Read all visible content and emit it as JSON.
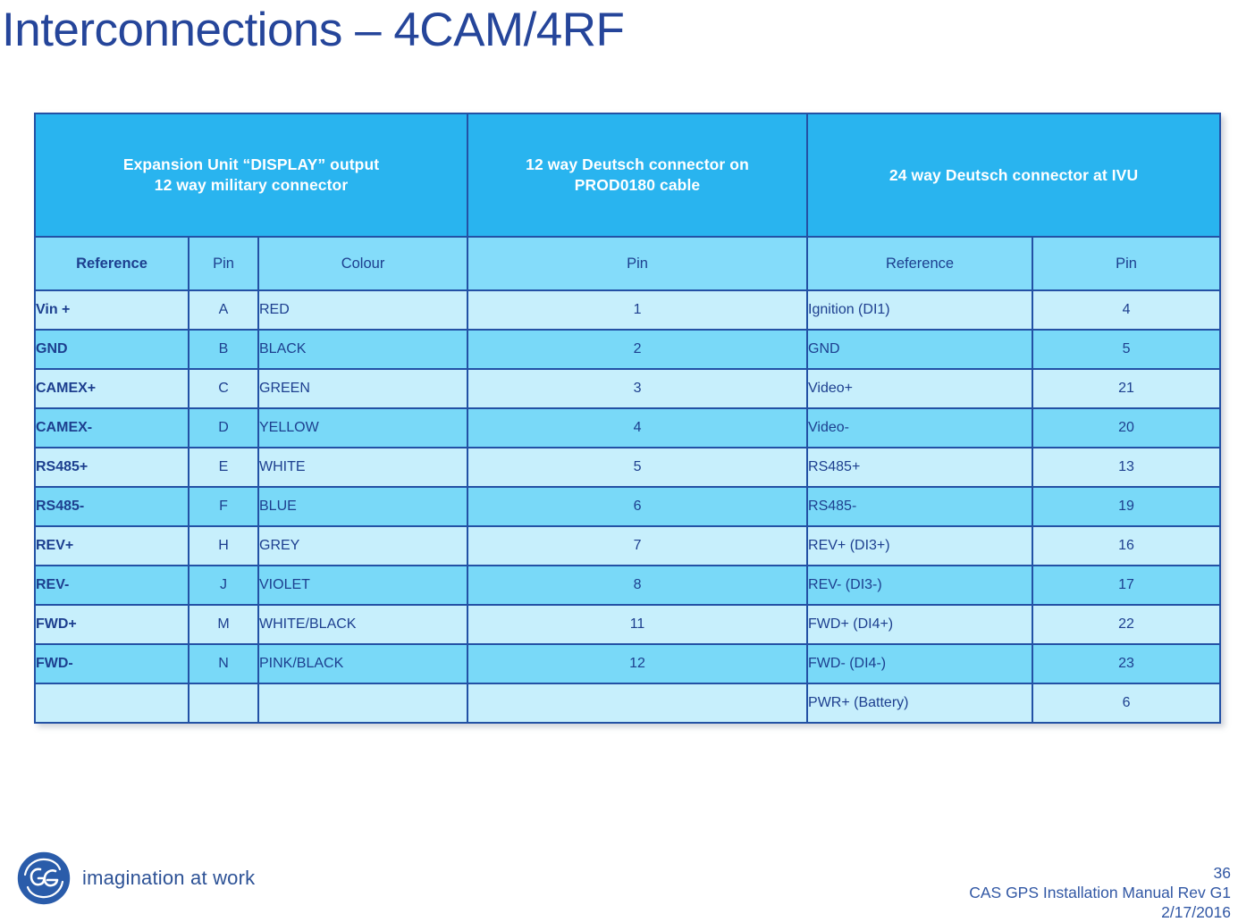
{
  "slide": {
    "title": "Interconnections – 4CAM/4RF",
    "title_color": "#25459a"
  },
  "colors": {
    "group_header_bg": "#29b4ef",
    "sub_header_bg": "#84dcfa",
    "row_light_bg": "#c7effc",
    "row_dark_bg": "#79d9f8",
    "border": "#2351a5",
    "text": "#1d3f8f"
  },
  "table": {
    "group_headers": [
      {
        "label": "Expansion Unit “DISPLAY” output\n12 way military connector",
        "line1": "Expansion Unit “DISPLAY” output",
        "line2": "12 way military connector",
        "colspan": 3
      },
      {
        "label": "12 way Deutsch connector on\nPROD0180 cable",
        "line1": "12 way Deutsch connector on",
        "line2": "PROD0180 cable",
        "colspan": 1
      },
      {
        "label": "24 way Deutsch connector at IVU",
        "line1": "24 way Deutsch connector at IVU",
        "line2": "",
        "colspan": 2
      }
    ],
    "column_headers": [
      "Reference",
      "Pin",
      "Colour",
      "Pin",
      "Reference",
      "Pin"
    ],
    "rows": [
      {
        "reference": "Vin +",
        "pin": "A",
        "colour": "RED",
        "cable_pin": "1",
        "ivu_reference": "Ignition (DI1)",
        "ivu_pin": "4"
      },
      {
        "reference": "GND",
        "pin": "B",
        "colour": "BLACK",
        "cable_pin": "2",
        "ivu_reference": "GND",
        "ivu_pin": "5"
      },
      {
        "reference": "CAMEX+",
        "pin": "C",
        "colour": "GREEN",
        "cable_pin": "3",
        "ivu_reference": "Video+",
        "ivu_pin": "21"
      },
      {
        "reference": "CAMEX-",
        "pin": "D",
        "colour": "YELLOW",
        "cable_pin": "4",
        "ivu_reference": "Video-",
        "ivu_pin": "20"
      },
      {
        "reference": "RS485+",
        "pin": "E",
        "colour": "WHITE",
        "cable_pin": "5",
        "ivu_reference": "RS485+",
        "ivu_pin": "13"
      },
      {
        "reference": "RS485-",
        "pin": "F",
        "colour": "BLUE",
        "cable_pin": "6",
        "ivu_reference": "RS485-",
        "ivu_pin": "19"
      },
      {
        "reference": "REV+",
        "pin": "H",
        "colour": "GREY",
        "cable_pin": "7",
        "ivu_reference": "REV+   (DI3+)",
        "ivu_pin": "16"
      },
      {
        "reference": "REV-",
        "pin": "J",
        "colour": "VIOLET",
        "cable_pin": "8",
        "ivu_reference": "REV-    (DI3-)",
        "ivu_pin": "17"
      },
      {
        "reference": "FWD+",
        "pin": "M",
        "colour": "WHITE/BLACK",
        "cable_pin": "11",
        "ivu_reference": "FWD+   (DI4+)",
        "ivu_pin": "22"
      },
      {
        "reference": "FWD-",
        "pin": "N",
        "colour": "PINK/BLACK",
        "cable_pin": "12",
        "ivu_reference": "FWD-    (DI4-)",
        "ivu_pin": "23"
      },
      {
        "reference": "",
        "pin": "",
        "colour": "",
        "cable_pin": "",
        "ivu_reference": "PWR+  (Battery)",
        "ivu_pin": "6"
      }
    ]
  },
  "footer": {
    "brand_tagline": "imagination at work",
    "logo_name": "GE",
    "page_number": "36",
    "document": "CAS GPS Installation Manual Rev G1",
    "date": "2/17/2016"
  }
}
